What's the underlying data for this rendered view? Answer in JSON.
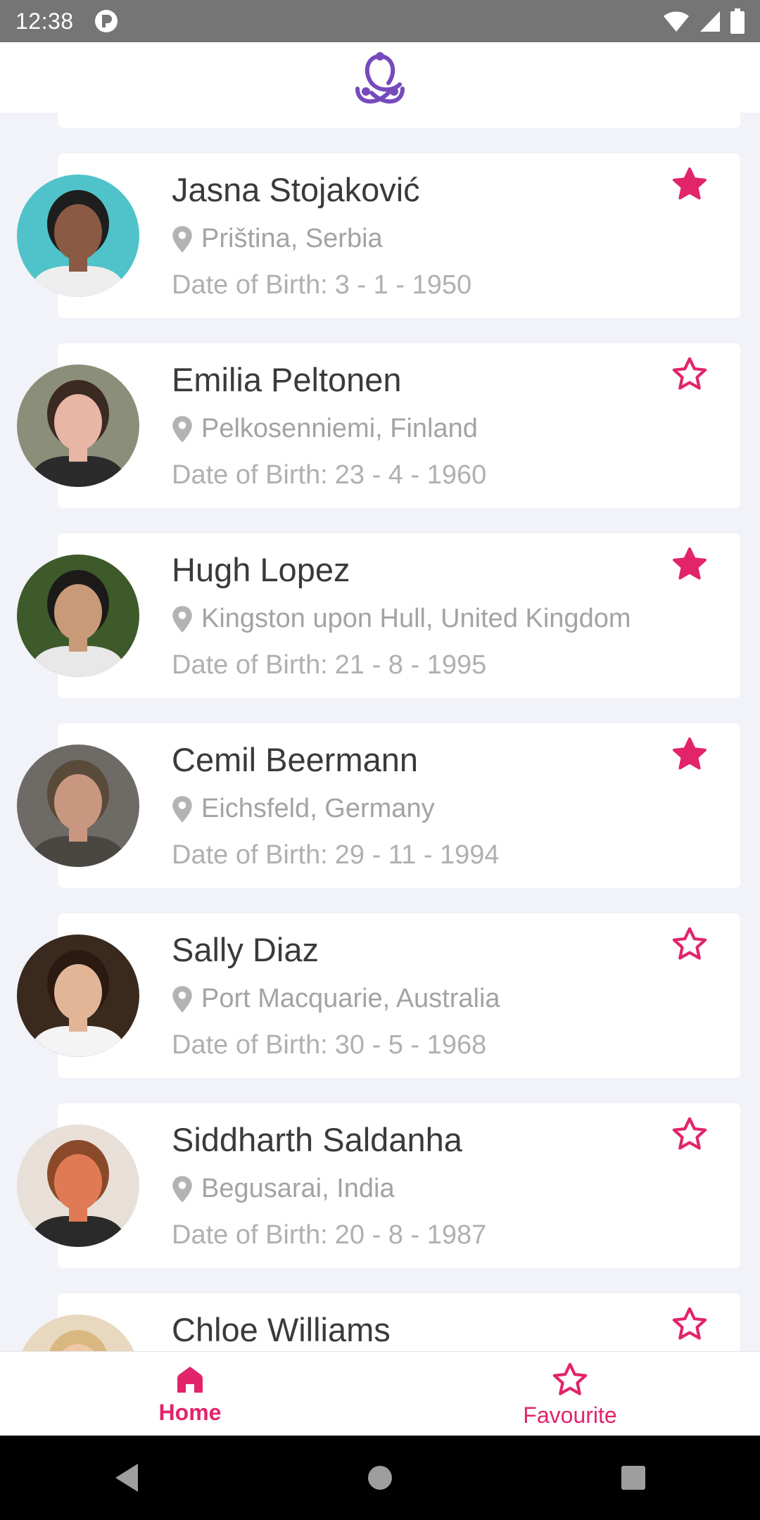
{
  "status_bar": {
    "time": "12:38"
  },
  "people": [
    {
      "name": "Jasna Stojaković",
      "location": "Priština, Serbia",
      "dob_label": "Date of Birth:",
      "dob": "3 - 1 - 1950",
      "favourite": true,
      "avatar_bg": "#4fc3c9",
      "skin": "#8a5a44",
      "hair": "#1e1e1e",
      "shirt": "#eeeeee"
    },
    {
      "name": "Emilia Peltonen",
      "location": "Pelkosenniemi, Finland",
      "dob_label": "Date of Birth:",
      "dob": "23 - 4 - 1960",
      "favourite": false,
      "avatar_bg": "#8b8f7a",
      "skin": "#e8b6a5",
      "hair": "#3b2a22",
      "shirt": "#2b2b2b"
    },
    {
      "name": "Hugh Lopez",
      "location": "Kingston upon Hull, United Kingdom",
      "dob_label": "Date of Birth:",
      "dob": "21 - 8 - 1995",
      "favourite": true,
      "avatar_bg": "#3f5a2a",
      "skin": "#c89a78",
      "hair": "#1c1a18",
      "shirt": "#e8e8e8"
    },
    {
      "name": "Cemil Beermann",
      "location": "Eichsfeld, Germany",
      "dob_label": "Date of Birth:",
      "dob": "29 - 11 - 1994",
      "favourite": true,
      "avatar_bg": "#6e6a66",
      "skin": "#c9977f",
      "hair": "#5a4a3a",
      "shirt": "#4a4642"
    },
    {
      "name": "Sally Diaz",
      "location": "Port Macquarie, Australia",
      "dob_label": "Date of Birth:",
      "dob": "30 - 5 - 1968",
      "favourite": false,
      "avatar_bg": "#3a2a1e",
      "skin": "#e2b596",
      "hair": "#2a1a12",
      "shirt": "#f4f4f4"
    },
    {
      "name": "Siddharth Saldanha",
      "location": "Begusarai, India",
      "dob_label": "Date of Birth:",
      "dob": "20 - 8 - 1987",
      "favourite": false,
      "avatar_bg": "#e8e0d8",
      "skin": "#e07a55",
      "hair": "#8a4a2a",
      "shirt": "#2a2a2a"
    },
    {
      "name": "Chloe Williams",
      "location": "",
      "dob_label": "",
      "dob": "",
      "favourite": false,
      "avatar_bg": "#e8d8c0",
      "skin": "#f0c8a8",
      "hair": "#d8b880",
      "shirt": "#cccccc"
    }
  ],
  "bottom_nav": {
    "home_label": "Home",
    "favourite_label": "Favourite"
  },
  "colors": {
    "accent": "#e2246b",
    "brand": "#764abc",
    "name_text": "#3a3a3a",
    "secondary_text": "#a3a3a3"
  }
}
